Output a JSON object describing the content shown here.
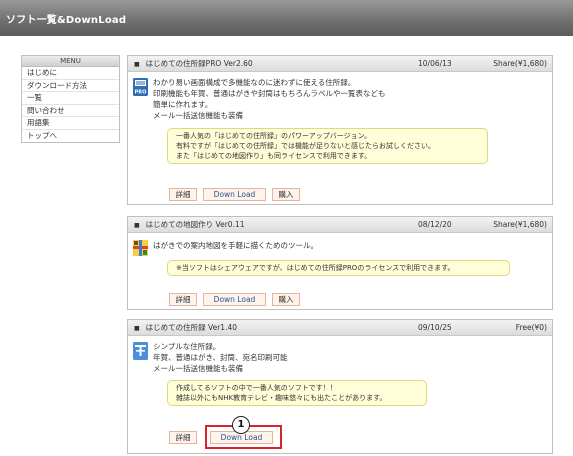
{
  "header": {
    "title": "ソフト一覧&DownLoad"
  },
  "sidebar": {
    "menu_label": "MENU",
    "items": [
      "はじめに",
      "ダウンロード方法",
      "一覧",
      "問い合わせ",
      "用語集",
      "トップへ"
    ]
  },
  "panels": [
    {
      "title": "はじめての住所録PRO Ver2.60",
      "date": "10/06/13",
      "price": "Share(¥1,680)",
      "desc": [
        "わかり易い画面構成で多機能なのに迷わずに使える住所録。",
        "印刷機能も年賀、普通はがきや封筒はもちろんラベルや一覧表なども",
        "簡単に作れます。",
        "メール一括送信機能も装備"
      ],
      "note": [
        "一番人気の「はじめての住所録」のパワーアップバージョン。",
        "有料ですが「はじめての住所録」では機能が足りないと感じたらお試しください。",
        "また「はじめての地図作り」も同ライセンスで利用できます。"
      ],
      "buttons": {
        "detail": "詳細",
        "download": "Down Load",
        "buy": "購入"
      },
      "icon": "pro-address-book-icon"
    },
    {
      "title": "はじめての地図作り Ver0.11",
      "date": "08/12/20",
      "price": "Share(¥1,680)",
      "desc": [
        "はがきでの案内地図を手軽に描くためのツール。"
      ],
      "note": [
        "※当ソフトはシェアウェアですが、はじめての住所録PROのライセンスで利用できます。"
      ],
      "buttons": {
        "detail": "詳細",
        "download": "Down Load",
        "buy": "購入"
      },
      "icon": "map-maker-icon"
    },
    {
      "title": "はじめての住所録 Ver1.40",
      "date": "09/10/25",
      "price": "Free(¥0)",
      "desc": [
        "シンプルな住所録。",
        "年賀、普通はがき、封筒、宛名印刷可能",
        "メール一括送信機能も装備"
      ],
      "note": [
        "作成してるソフトの中で一番人気のソフトです！！",
        "雑誌以外にもNHK教育テレビ・趣味悠々にも出たことがあります。"
      ],
      "buttons": {
        "detail": "詳細",
        "download": "Down Load"
      },
      "icon": "address-book-icon"
    }
  ],
  "annotation": {
    "callout_number": "1",
    "highlight_color": "#d9232b"
  }
}
